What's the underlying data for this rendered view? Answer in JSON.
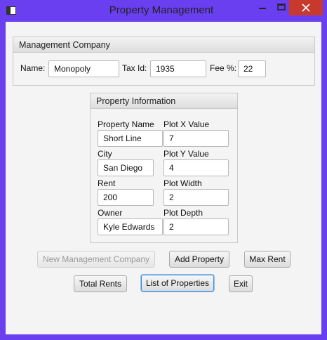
{
  "window": {
    "title": "Property Management",
    "colors": {
      "frame": "#6a3ff0",
      "close": "#c7392d"
    }
  },
  "management": {
    "header": "Management Company",
    "name_label": "Name:",
    "name_value": "Monopoly",
    "taxid_label": "Tax Id:",
    "taxid_value": "1935",
    "fee_label": "Fee %:",
    "fee_value": "22"
  },
  "property": {
    "header": "Property Information",
    "name_label": "Property Name",
    "name_value": "Short Line",
    "plotx_label": "Plot X Value",
    "plotx_value": "7",
    "city_label": "City",
    "city_value": "San Diego",
    "ploty_label": "Plot Y Value",
    "ploty_value": "4",
    "rent_label": "Rent",
    "rent_value": "200",
    "width_label": "Plot Width",
    "width_value": "2",
    "owner_label": "Owner",
    "owner_value": "Kyle Edwards",
    "depth_label": "Plot Depth",
    "depth_value": "2"
  },
  "buttons": {
    "new_mgmt": "New Management Company",
    "add_property": "Add Property",
    "max_rent": "Max Rent",
    "total_rents": "Total Rents",
    "list_properties": "List of Properties",
    "exit": "Exit"
  }
}
